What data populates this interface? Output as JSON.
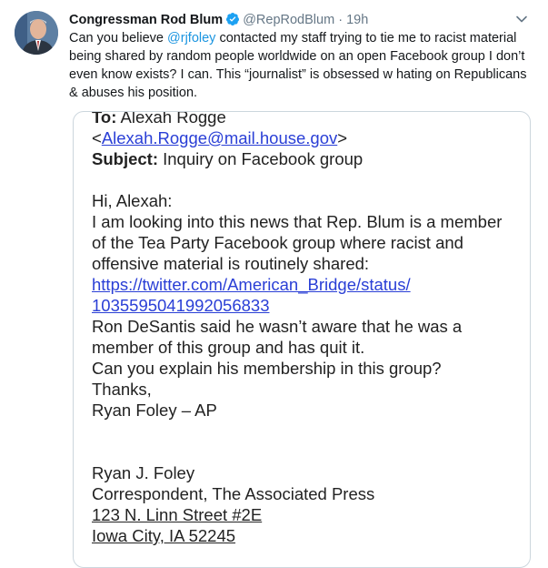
{
  "author": {
    "name": "Congressman Rod Blum",
    "handle": "@RepRodBlum",
    "separator": "·",
    "time": "19h"
  },
  "tweet": {
    "text_before": "Can you believe ",
    "mention": "@rjfoley",
    "text_after": " contacted my staff trying to tie me to racist material being shared by random people worldwide on an open Facebook group I don’t even know exists? I can. This “journalist” is obsessed w hating on Republicans & abuses his position."
  },
  "email": {
    "to_label": "To:",
    "to_name": "Alexah Rogge",
    "to_open": "<",
    "to_email": "Alexah.Rogge@mail.house.gov",
    "to_close": ">",
    "subject_label": "Subject:",
    "subject": "Inquiry on Facebook group",
    "greeting": "Hi, Alexah:",
    "body_lines": [
      "I am looking into this news that Rep. Blum is a member",
      "of the Tea Party Facebook group where racist and",
      "offensive material is routinely shared:"
    ],
    "link_line1": "https://twitter.com/American_Bridge/status/",
    "link_line2": "1035595041992056833",
    "body_lines2": [
      "Ron DeSantis said he wasn’t aware that he was a",
      "member of this group and has quit it.",
      "Can you explain his membership in this group?",
      "Thanks,",
      "Ryan Foley – AP"
    ],
    "sig_name": "Ryan J. Foley",
    "sig_title": "Correspondent, The Associated Press",
    "sig_street": "123 N. Linn Street #2E",
    "sig_city": "Iowa City, IA  52245"
  },
  "colors": {
    "link_blue": "#1b95e0",
    "verified_blue": "#1da1f2",
    "muted_gray": "#657786"
  },
  "icons": [
    "verified-badge-icon",
    "chevron-down-icon"
  ]
}
